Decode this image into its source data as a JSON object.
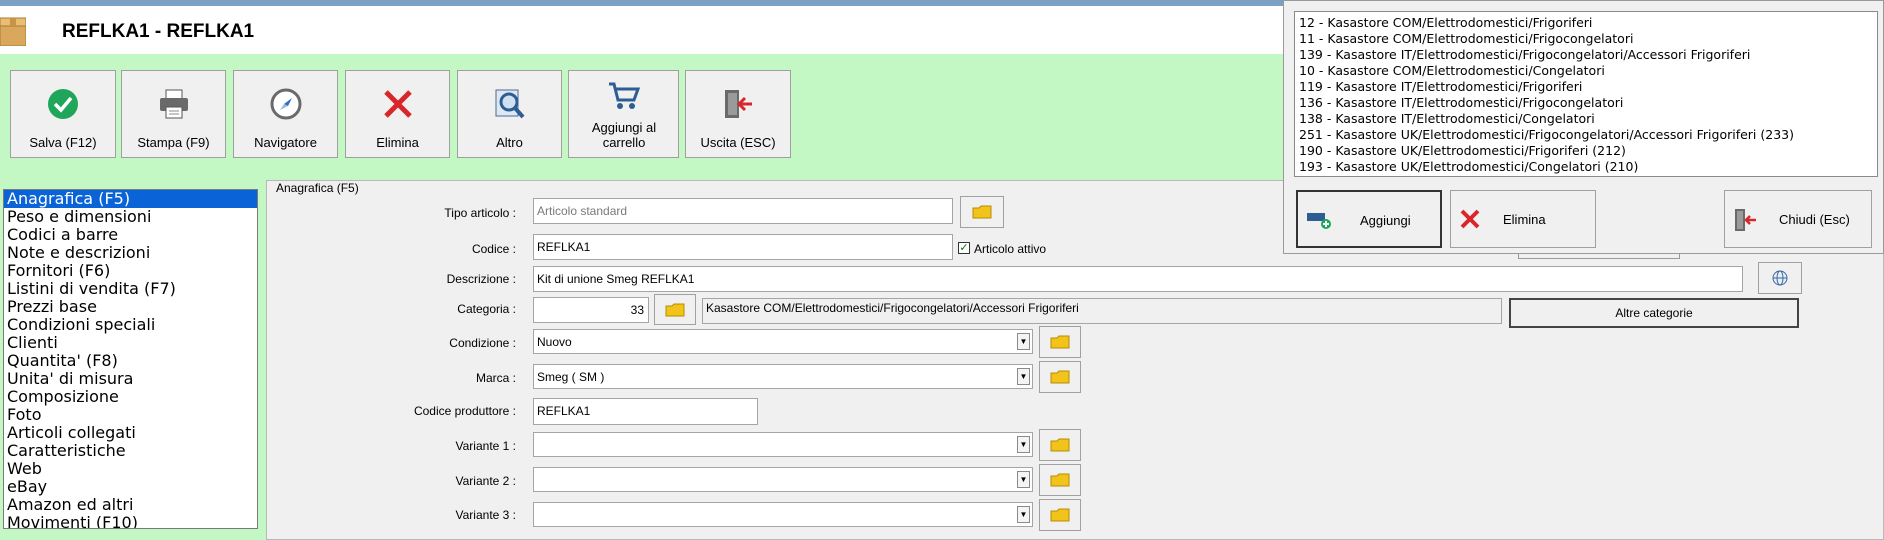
{
  "window": {
    "title": "REFLKA1 - REFLKA1"
  },
  "toolbar": [
    {
      "name": "save-button",
      "icon": "check-circle-icon",
      "label": "Salva (F12)"
    },
    {
      "name": "print-button",
      "icon": "printer-icon",
      "label": "Stampa (F9)"
    },
    {
      "name": "navigator-button",
      "icon": "compass-icon",
      "label": "Navigatore"
    },
    {
      "name": "delete-button",
      "icon": "red-x-icon",
      "label": "Elimina"
    },
    {
      "name": "other-button",
      "icon": "magnifier-icon",
      "label": "Altro"
    },
    {
      "name": "add-to-cart-button",
      "icon": "cart-icon",
      "label": "Aggiungi al carrello"
    },
    {
      "name": "exit-button",
      "icon": "exit-door-icon",
      "label": "Uscita (ESC)"
    }
  ],
  "nav": {
    "selected": 0,
    "items": [
      "Anagrafica (F5)",
      "Peso e dimensioni",
      "Codici a barre",
      "Note e descrizioni",
      "Fornitori (F6)",
      "Listini di vendita (F7)",
      "Prezzi base",
      "Condizioni speciali",
      "Clienti",
      "Quantita' (F8)",
      "Unita' di misura",
      "Composizione",
      "Foto",
      "Articoli collegati",
      "Caratteristiche",
      "Web",
      "eBay",
      "Amazon ed altri",
      "Movimenti (F10)"
    ]
  },
  "form": {
    "legend": "Anagrafica (F5)",
    "tipo_label": "Tipo articolo :",
    "tipo_value": "Articolo standard",
    "codice_label": "Codice :",
    "codice_value": "REFLKA1",
    "attivo_label": "Articolo attivo",
    "attivo_checked": true,
    "descrizione_label": "Descrizione :",
    "descrizione_value": "Kit di unione Smeg REFLKA1",
    "categoria_label": "Categoria :",
    "categoria_id": "33",
    "categoria_path": "Kasastore COM/Elettrodomestici/Frigocongelatori/Accessori Frigoriferi",
    "altre_categorie_label": "Altre categorie",
    "condizione_label": "Condizione :",
    "condizione_value": "Nuovo",
    "marca_label": "Marca :",
    "marca_value": "Smeg ( SM )",
    "codice_produttore_label": "Codice produttore :",
    "codice_produttore_value": "REFLKA1",
    "variante1_label": "Variante 1 :",
    "variante1_value": "",
    "variante2_label": "Variante 2 :",
    "variante2_value": "",
    "variante3_label": "Variante 3 :",
    "variante3_value": ""
  },
  "popup": {
    "categories": [
      "12 - Kasastore COM/Elettrodomestici/Frigoriferi",
      "11 - Kasastore COM/Elettrodomestici/Frigocongelatori",
      "139 - Kasastore IT/Elettrodomestici/Frigocongelatori/Accessori Frigoriferi",
      "10 - Kasastore COM/Elettrodomestici/Congelatori",
      "119 - Kasastore IT/Elettrodomestici/Frigoriferi",
      "136 - Kasastore IT/Elettrodomestici/Frigocongelatori",
      "138 - Kasastore IT/Elettrodomestici/Congelatori",
      "251 - Kasastore UK/Elettrodomestici/Frigocongelatori/Accessori Frigoriferi (233)",
      "190 - Kasastore UK/Elettrodomestici/Frigoriferi (212)",
      "193 - Kasastore UK/Elettrodomestici/Congelatori (210)"
    ],
    "add_label": "Aggiungi",
    "delete_label": "Elimina",
    "close_label": "Chiudi (Esc)"
  },
  "colors": {
    "background": "#c3f7c3",
    "selection": "#0a64d8",
    "delete_red": "#d9262b"
  }
}
